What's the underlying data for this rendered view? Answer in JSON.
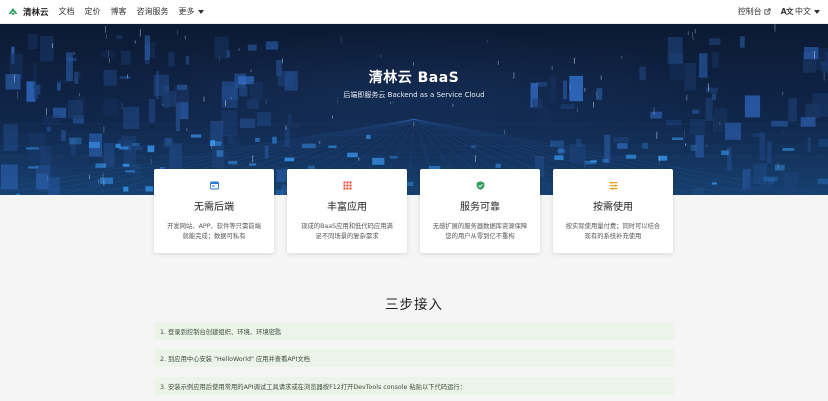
{
  "nav": {
    "brand": "清林云",
    "links": [
      {
        "label": "文档"
      },
      {
        "label": "定价"
      },
      {
        "label": "博客"
      },
      {
        "label": "咨询服务"
      },
      {
        "label": "更多"
      }
    ],
    "console": "控制台",
    "language": "中文",
    "language_icon": "A文"
  },
  "hero": {
    "title": "清林云 BaaS",
    "subtitle": "后端即服务云 Backend as a Service Cloud"
  },
  "cards": [
    {
      "icon": "browser-window-icon",
      "title": "无需后端",
      "desc": "开发网站、APP、软件等只需前端就能完成；数据可私有"
    },
    {
      "icon": "grid-apps-icon",
      "title": "丰富应用",
      "desc": "现成的BaaS应用和低代码应用满足不同场景的复杂需求"
    },
    {
      "icon": "shield-check-icon",
      "title": "服务可靠",
      "desc": "无感扩展的服务器数据库资源保障您的用户从零到亿不重构"
    },
    {
      "icon": "list-settings-icon",
      "title": "按需使用",
      "desc": "按实际使用量付费；同时可以结合现有的系统补充使用"
    }
  ],
  "steps": {
    "title": "三步接入",
    "items": [
      "1. 登录到控制台创建组织、环境、环境密匙",
      "2. 到应用中心安装 \"HelloWorld\" 应用并查看API文档",
      "3. 安装示例应用后使用常用的API调试工具请求或在浏览器按F12打开DevTools console 粘贴以下代码运行："
    ]
  },
  "colors": {
    "brand_green": "#2f9e5a",
    "hero_dark": "#0c1a33",
    "step_bg": "#ecf4ea"
  }
}
